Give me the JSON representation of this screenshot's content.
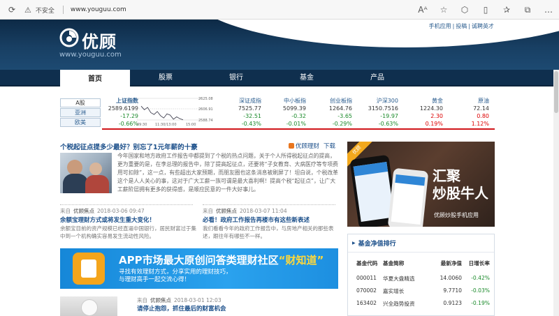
{
  "browser": {
    "security_label": "不安全",
    "url": "www.youguu.com"
  },
  "header": {
    "logo_text": "优顾",
    "logo_url": "www.youguu.com",
    "top_links": [
      "手机应用",
      "投稿",
      "诚聘英才"
    ],
    "top_link_sep": "|"
  },
  "nav": {
    "items": [
      "首页",
      "股票",
      "银行",
      "基金",
      "产品"
    ],
    "active": "首页"
  },
  "market": {
    "tabs": [
      "A股",
      "亚洲",
      "欧美"
    ],
    "main_index": {
      "name": "上证指数",
      "value": "2589.6199",
      "change": "-17.29",
      "pct": "-0.66%"
    },
    "spark_labels": {
      "y_top": "2625.08",
      "y_mid": "2606.91",
      "y_bot": "2588.74",
      "x1": "09:30",
      "x2": "11:30/13:00",
      "x3": "15:00"
    },
    "spark_values": [
      2612,
      2606,
      2610,
      2601,
      2598,
      2603,
      2596,
      2592,
      2599,
      2597,
      2590,
      2594,
      2591,
      2589
    ],
    "indices": [
      {
        "name": "深证成指",
        "value": "7525.77",
        "change": "-32.51",
        "pct": "-0.43%"
      },
      {
        "name": "中小板指",
        "value": "5099.39",
        "change": "-0.32",
        "pct": "-0.01%"
      },
      {
        "name": "创业板指",
        "value": "1264.76",
        "change": "-3.65",
        "pct": "-0.29%"
      },
      {
        "name": "沪深300",
        "value": "3150.7516",
        "change": "-19.97",
        "pct": "-0.63%"
      },
      {
        "name": "黄金",
        "value": "1224.30",
        "change": "2.30",
        "pct": "0.19%"
      },
      {
        "name": "原油",
        "value": "72.14",
        "change": "0.80",
        "pct": "1.12%"
      }
    ]
  },
  "main_news": {
    "headline": "个税起征点提多少最好？别忘了1元年薪的十豪",
    "app_link": "优顾理财",
    "app_download": "下载",
    "body": "今年国家和地方政府工作报告中都提到了个税的热点问题，关于个人所得税起征点的提高，更为重要的是，在李总理的报告中，除了提高起征点，还要将“子女教育、大病医疗等专项费用可扣除”，这一点，有些超出大家预期，而朋友圈也这条消息被刷屏了！坦白说，个税改革这个是人人关心的事，这对于广大工薪一族可谓是最大喜利啊！提高个税“起征点”，让广大工薪阶层拥有更多的获得感，是顺应民意的一件大好事儿。"
  },
  "sub_news": [
    {
      "source_label": "来自",
      "source": "优顾焦点",
      "date": "2018-03-06 09:47",
      "title": "余额宝理财方式或将发生重大变化！",
      "text": "余额宝目前的资产规模已经直逼中国银行，居民财富过于集中到一个机构确实容易发生流动性风险。"
    },
    {
      "source_label": "来自",
      "source": "优顾焦点",
      "date": "2018-03-07 11:04",
      "title": "必看！政府工作报告再楼市有这些新表述",
      "text": "我们看看今年的政府工作报告中，与房地产相关的那些表述，跟往年有哪些不一样。"
    }
  ],
  "banner": {
    "title_main": "APP市场最大原创问答类理财社区",
    "title_highlight": "“财知道”",
    "sub1": "寻找有效理财方式，分享实用的理财技巧，",
    "sub2": "与理财高手一起交流心得！"
  },
  "bottom_news": {
    "source_label": "来自",
    "source": "优顾焦点",
    "date": "2018-03-01 12:03",
    "title": "请停止抱怨，抓住最后的财富机会"
  },
  "ad": {
    "corner": "优顾",
    "line1": "汇聚",
    "line2": "炒股牛人",
    "line3": "优顾炒股手机应用"
  },
  "fund_rank": {
    "title": "基金净值排行",
    "columns": [
      "基金代码",
      "基金简称",
      "最新净值",
      "日增长率"
    ],
    "rows": [
      {
        "code": "000011",
        "name": "华夏大盘精选",
        "nav": "14.0060",
        "growth": "-0.42%"
      },
      {
        "code": "070002",
        "name": "嘉实增长",
        "nav": "9.7710",
        "growth": "-0.03%"
      },
      {
        "code": "163402",
        "name": "兴全趋势投资",
        "nav": "0.9123",
        "growth": "-0.19%"
      }
    ]
  },
  "colors": {
    "accent": "#1b4f8a",
    "up": "#dd0000",
    "down": "#1a8a2a",
    "nav_bg": "#0f2f4e",
    "red_line": "#d0151a"
  }
}
